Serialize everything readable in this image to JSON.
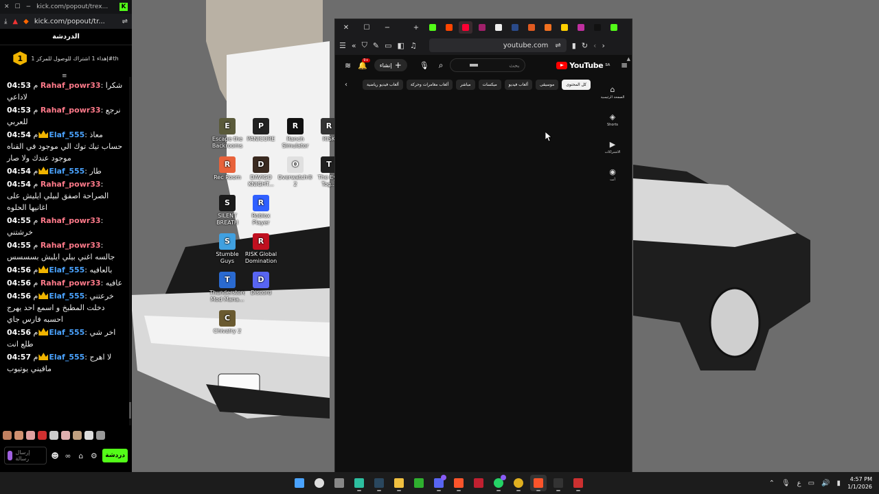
{
  "chat_window": {
    "url": "kick.com/popout/trex...",
    "url_tab": "kick.com/popout/tr...",
    "header_title": "الدردشة",
    "goal": {
      "number": "1",
      "text": "إهداء 1 اشتراك للوصول للمركز 1#th"
    },
    "messages": [
      {
        "time": "04:53",
        "suffix": "م",
        "badge": false,
        "user": "Rahaf_powr33",
        "color": "#ff7a8a",
        "text": "شكرا لاداعي"
      },
      {
        "time": "04:53",
        "suffix": "م",
        "badge": false,
        "user": "Rahaf_powr33",
        "color": "#ff7a8a",
        "text": "نرجع للعربي"
      },
      {
        "time": "04:54",
        "suffix": "م",
        "badge": true,
        "user": "Elaf_555",
        "color": "#4aa3ff",
        "text": "معاذ حساب تيك توك الي موجود في القناه موجود عندك ولا صار"
      },
      {
        "time": "04:54",
        "suffix": "م",
        "badge": true,
        "user": "Elaf_555",
        "color": "#4aa3ff",
        "text": "طار"
      },
      {
        "time": "04:54",
        "suffix": "م",
        "badge": false,
        "user": "Rahaf_powr33",
        "color": "#ff7a8a",
        "text": "الصراحة اصفق لبيلي ايليش على اغانيها الحلوه"
      },
      {
        "time": "04:55",
        "suffix": "م",
        "badge": false,
        "user": "Rahaf_powr33",
        "color": "#ff7a8a",
        "text": "خرشتني"
      },
      {
        "time": "04:55",
        "suffix": "م",
        "badge": false,
        "user": "Rahaf_powr33",
        "color": "#ff7a8a",
        "text": "جالسه اغني بيلي ايليش بسسسس"
      },
      {
        "time": "04:56",
        "suffix": "م",
        "badge": true,
        "user": "Elaf_555",
        "color": "#4aa3ff",
        "text": "بالعافيه"
      },
      {
        "time": "04:56",
        "suffix": "م",
        "badge": false,
        "user": "Rahaf_powr33",
        "color": "#ff7a8a",
        "text": "عافيه"
      },
      {
        "time": "04:56",
        "suffix": "م",
        "badge": true,
        "user": "Elaf_555",
        "color": "#4aa3ff",
        "text": "خرعتني دخلت المطبخ و اسمع احد يهرج احسبه فارس جاي"
      },
      {
        "time": "04:56",
        "suffix": "م",
        "badge": true,
        "user": "Elaf_555",
        "color": "#4aa3ff",
        "text": "اخر شي طلع انت"
      },
      {
        "time": "04:57",
        "suffix": "م",
        "badge": true,
        "user": "Elaf_555",
        "color": "#4aa3ff",
        "text": "لا اهرج مافيني يوتيوب"
      }
    ],
    "input_placeholder": "إرسال رسالة",
    "send_label": "دردشة"
  },
  "desktop_icons": [
    {
      "label": "Escape the Backrooms",
      "color": "#5a5a3a",
      "glyph": "E"
    },
    {
      "label": "PANICORE",
      "color": "#222222",
      "glyph": "P"
    },
    {
      "label": "Ranch Simulator",
      "color": "#111111",
      "glyph": "R"
    },
    {
      "label": "RISK",
      "color": "#333333",
      "glyph": "R"
    },
    {
      "label": "Rec Room",
      "color": "#e8623a",
      "glyph": "R"
    },
    {
      "label": "DAVIGO KNIGHT...",
      "color": "#3a2a20",
      "glyph": "D"
    },
    {
      "label": "Overwatch® 2",
      "color": "#e0e0e0",
      "glyph": "O"
    },
    {
      "label": "The Eye Tog...",
      "color": "#202020",
      "glyph": "T"
    },
    {
      "label": "SILENT BREATH",
      "color": "#1a1a1a",
      "glyph": "S"
    },
    {
      "label": "Roblox Player",
      "color": "#3060ff",
      "glyph": "R"
    },
    {
      "label": "Stumble Guys",
      "color": "#40a0e0",
      "glyph": "S"
    },
    {
      "label": "RISK Global Domination",
      "color": "#c01020",
      "glyph": "R"
    },
    {
      "label": "Thunderstore Mod Mana...",
      "color": "#2a6ad0",
      "glyph": "T"
    },
    {
      "label": "Discord",
      "color": "#5865f2",
      "glyph": "D"
    },
    {
      "label": "Chivalry 2",
      "color": "#6a5a30",
      "glyph": "C"
    }
  ],
  "youtube_window": {
    "address": "youtube.com",
    "brand": "YouTube",
    "brand_sup": "SA",
    "create_label": "إنشاء",
    "notifications_badge": "9+",
    "search_placeholder": "بحث",
    "chips": [
      "كل المحتوى",
      "موسيقى",
      "ألعاب فيديو",
      "ميكسات",
      "مباشر",
      "ألعاب مغامرات وحركة",
      "ألعاب فيديو رياضية"
    ],
    "sidebar": [
      {
        "icon": "home-icon",
        "label": "الصفحة الرئيسية"
      },
      {
        "icon": "shorts-icon",
        "label": "Shorts"
      },
      {
        "icon": "subscriptions-icon",
        "label": "الاشتراكات"
      },
      {
        "icon": "you-icon",
        "label": "أنت"
      }
    ]
  },
  "taskbar": {
    "apps": [
      "start",
      "search",
      "files",
      "edge",
      "steam",
      "explorer",
      "xbox",
      "discord",
      "brave",
      "capture",
      "whatsapp",
      "chrome",
      "brave-active",
      "epic",
      "other"
    ],
    "tray_lang": "ع",
    "clock_time": "4:57 PM",
    "clock_date": "1/1/2026"
  }
}
